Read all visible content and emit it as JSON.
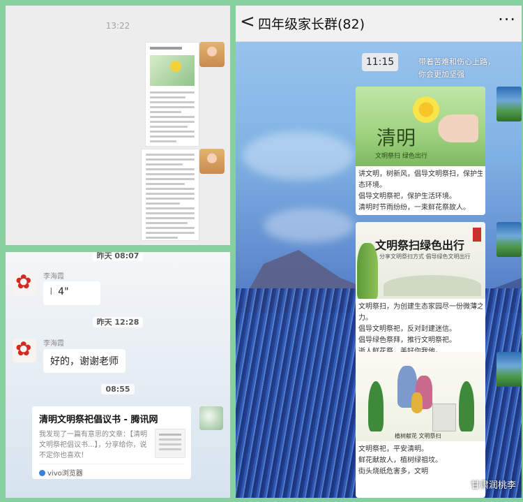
{
  "panel_a": {
    "time": "13:22"
  },
  "panel_b": {
    "timestamp_top": "昨天 08:07",
    "sender_name_1": "李海霞",
    "voice_duration": "4\"",
    "timestamp_mid": "昨天 12:28",
    "sender_name_2": "李海霞",
    "reply_text": "好的，谢谢老师",
    "timestamp_bottom": "08:55",
    "link_card": {
      "title": "清明文明祭祀倡议书 - 腾讯网",
      "description": "我发现了一篇有意思的文章：【清明文明祭祀倡议书...】，分享给你，说不定你也喜欢！",
      "source": "vivo浏览器"
    }
  },
  "panel_c": {
    "group_title": "四年级家长群(82)",
    "back_glyph": "<",
    "more_glyph": "···",
    "time_pill": "11:15",
    "poem_lines": [
      "带着苦难和伤心上路，",
      "你会更加坚强"
    ],
    "card_1": {
      "image_title": "清明",
      "image_subtitle": "文明祭扫  绿色出行",
      "lines": [
        "讲文明，树新风，倡导文明祭扫，保护生",
        "态环境。",
        "倡导文明祭祀，保护生活环境。",
        "清明时节雨纷纷，一束鲜花祭故人。"
      ]
    },
    "card_2": {
      "image_title": "文明祭扫绿色出行",
      "image_subtitle": "分享文明祭扫方式  倡导绿色文明出行",
      "lines": [
        "文明祭扫，为创建生态家园尽一份微薄之",
        "力。",
        "倡导文明祭祀，反对封建迷信。",
        "倡导绿色祭拜，推行文明祭祀。",
        "逝人鲜花祭，美好你我他。"
      ]
    },
    "card_3": {
      "image_caption": "植树献花  文明祭扫",
      "lines": [
        "文明祭祀，平安清明。",
        "鲜花献故人，植树绿祖坟。",
        "街头烧纸危害多，文明"
      ]
    },
    "watermark": "甘肃润桃李"
  },
  "colors": {
    "page_bg": "#86cf9e",
    "chat_bg_gray": "#ededed",
    "bubble": "#ffffff",
    "link_blue": "#3a7fe0"
  }
}
